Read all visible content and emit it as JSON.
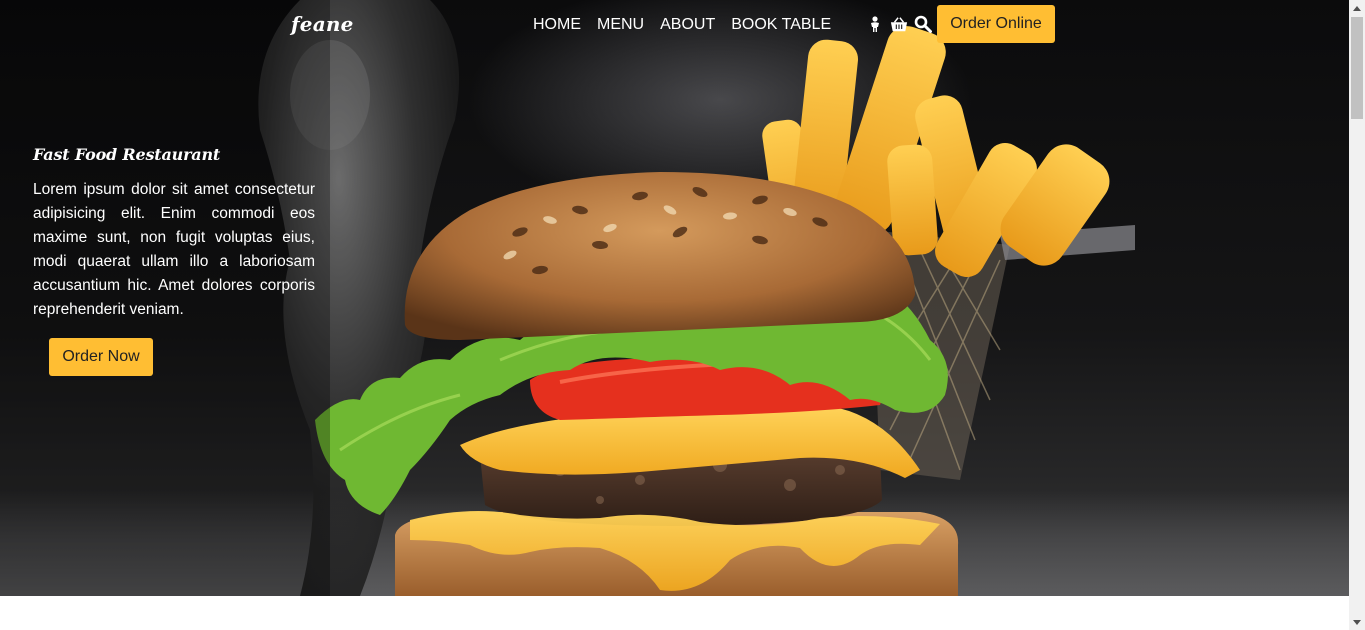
{
  "header": {
    "brand": "feane",
    "nav": [
      "HOME",
      "MENU",
      "ABOUT",
      "BOOK TABLE"
    ],
    "icons": [
      "user-icon",
      "cart-icon",
      "search-icon"
    ],
    "order_online_label": "Order Online"
  },
  "hero": {
    "title": "Fast Food Restaurant",
    "text": "Lorem ipsum dolor sit amet consectetur adipisicing elit. Enim commodi eos maxime sunt, non fugit voluptas eius, modi quaerat ullam illo a laboriosam accusantium hic. Amet dolores corporis reprehenderit veniam.",
    "order_now_label": "Order Now",
    "image": "burger-and-fries-photo"
  },
  "colors": {
    "accent": "#ffbe33",
    "hero_dark": "#0b0b0c",
    "text_light": "#ffffff"
  }
}
